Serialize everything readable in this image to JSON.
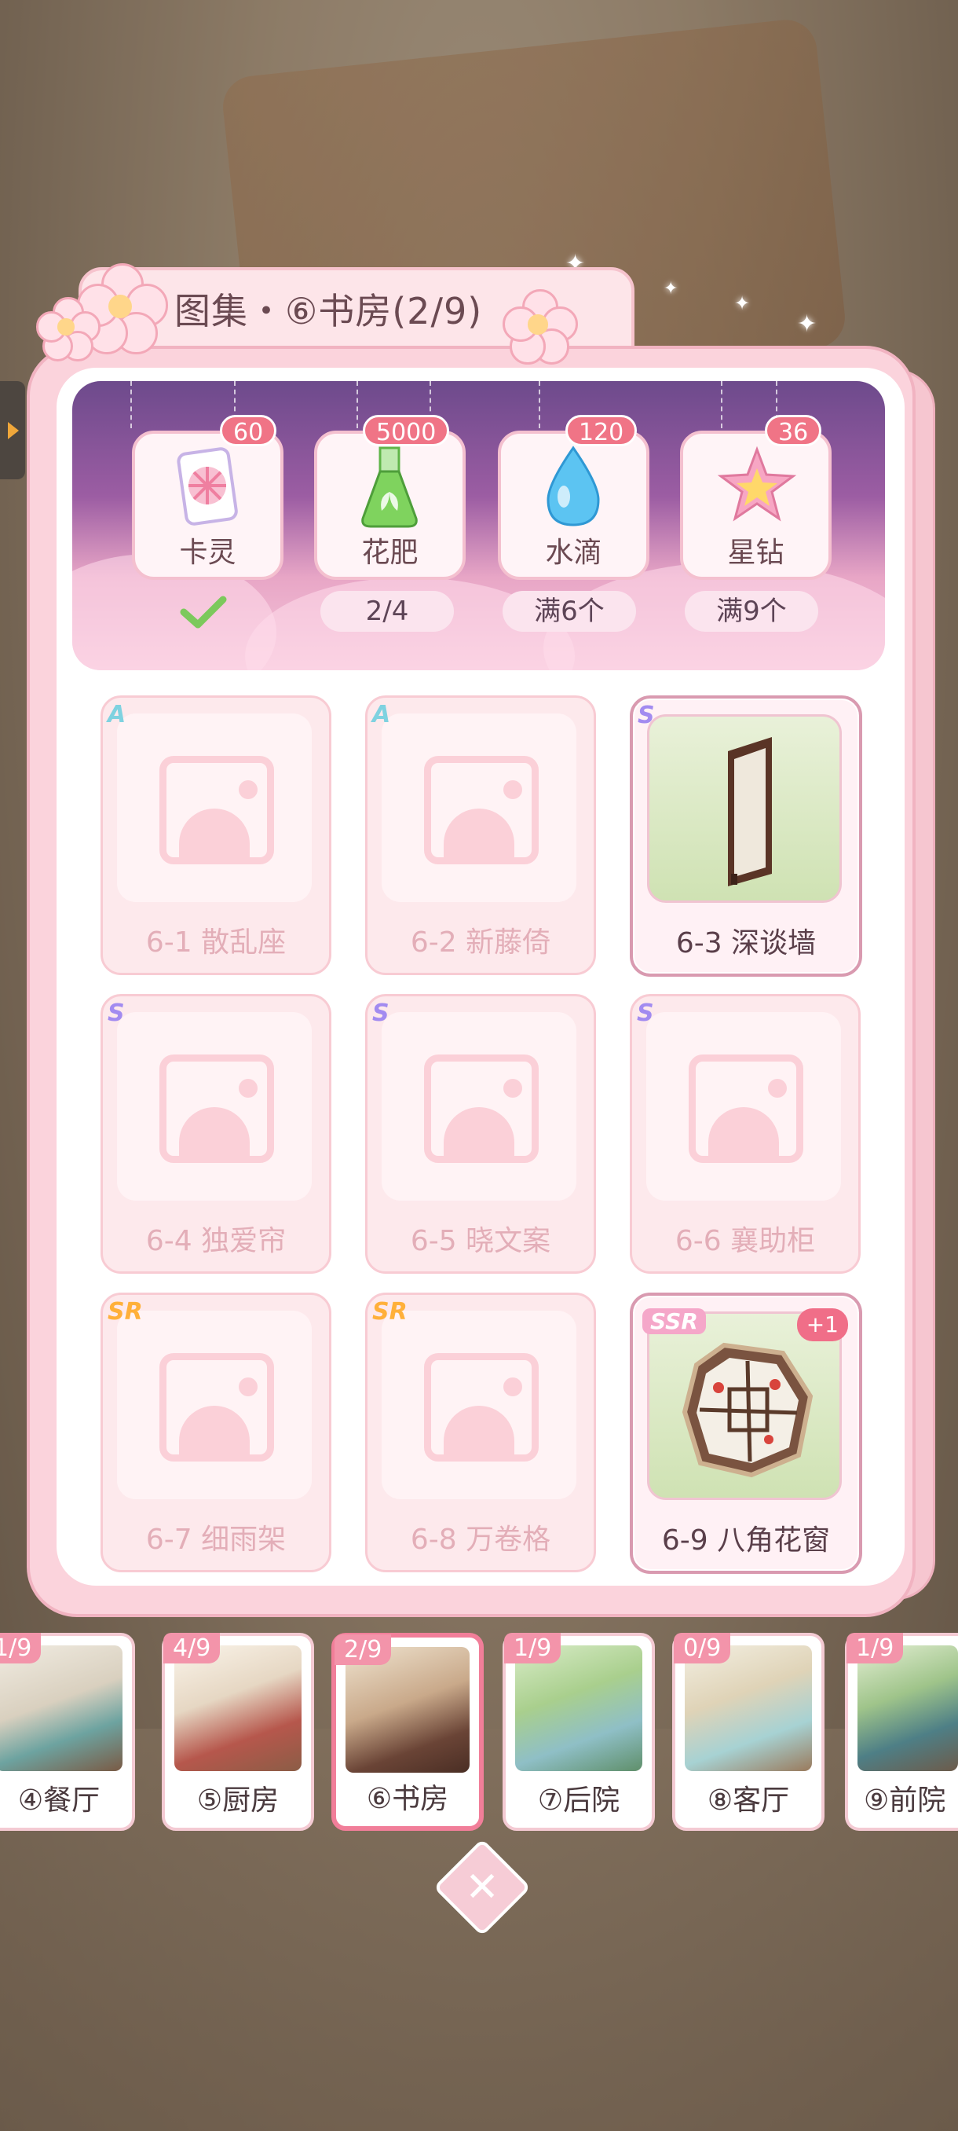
{
  "title": "图集・⑥书房(2/9)",
  "rewards": [
    {
      "name": "卡灵",
      "count": "60",
      "icon": "card-icon"
    },
    {
      "name": "花肥",
      "count": "5000",
      "icon": "fertilizer-flask-icon"
    },
    {
      "name": "水滴",
      "count": "120",
      "icon": "water-drop-icon"
    },
    {
      "name": "星钻",
      "count": "36",
      "icon": "star-diamond-icon"
    }
  ],
  "conditions": [
    "2/4",
    "满6个",
    "满9个"
  ],
  "items": [
    {
      "rank": "A",
      "name": "6-1 散乱座",
      "owned": false
    },
    {
      "rank": "A",
      "name": "6-2 新藤倚",
      "owned": false
    },
    {
      "rank": "S",
      "name": "6-3 深谈墙",
      "owned": true
    },
    {
      "rank": "S",
      "name": "6-4 独爱帘",
      "owned": false
    },
    {
      "rank": "S",
      "name": "6-5 晓文案",
      "owned": false
    },
    {
      "rank": "S",
      "name": "6-6 襄助柜",
      "owned": false
    },
    {
      "rank": "SR",
      "name": "6-7 细雨架",
      "owned": false
    },
    {
      "rank": "SR",
      "name": "6-8 万卷格",
      "owned": false
    },
    {
      "rank": "SSR",
      "name": "6-9 八角花窗",
      "owned": true,
      "extra": "+1"
    }
  ],
  "rooms": [
    {
      "count": "1/9",
      "name": "④餐厅"
    },
    {
      "count": "4/9",
      "name": "⑤厨房"
    },
    {
      "count": "2/9",
      "name": "⑥书房",
      "active": true
    },
    {
      "count": "1/9",
      "name": "⑦后院"
    },
    {
      "count": "0/9",
      "name": "⑧客厅"
    },
    {
      "count": "1/9",
      "name": "⑨前院"
    }
  ],
  "colors": {
    "accent": "#f07486",
    "panel": "#fbd3dc",
    "banner_top": "#6d4a8c"
  }
}
